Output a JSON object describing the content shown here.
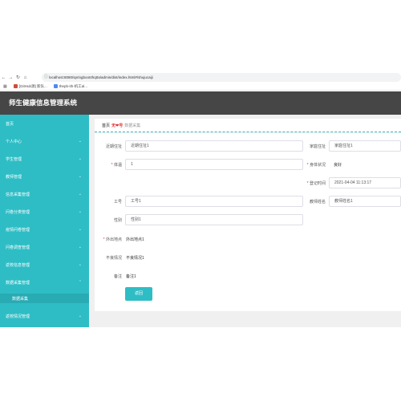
{
  "browser": {
    "url": "localhost:8080/springboot4hq0a/admin/dist/index.html#/shujucaiji",
    "bookmarks": [
      {
        "label": "[GitHub源] 新队...",
        "color": "#d4493a"
      },
      {
        "label": "thepb-ith-机工al...",
        "color": "#4a8af4"
      }
    ]
  },
  "app": {
    "title": "师生健康信息管理系统"
  },
  "sidebar": {
    "items": [
      {
        "label": "首页"
      },
      {
        "label": "个人中心"
      },
      {
        "label": "学生管理"
      },
      {
        "label": "教师管理"
      },
      {
        "label": "信息采集管理"
      },
      {
        "label": "问卷分类管理"
      },
      {
        "label": "疫情问卷管理"
      },
      {
        "label": "问卷调查管理"
      },
      {
        "label": "返校信息管理"
      },
      {
        "label": "数据采集管理"
      },
      {
        "label": "数据采集"
      },
      {
        "label": "返校情况管理"
      }
    ]
  },
  "breadcrumb": {
    "home": "首页",
    "separator": "无❤号",
    "current": "数据采集"
  },
  "form": {
    "recent_address_label": "近期住址",
    "recent_address_value": "近期住址1",
    "home_address_label": "家庭住址",
    "home_address_value": "家庭住址1",
    "temperature_label": "体温",
    "temperature_value": "1",
    "body_status_label": "身体状况",
    "body_status_value": "良好",
    "register_time_label": "登记时间",
    "register_time_value": "2021-04-04 11:13:17",
    "staff_id_label": "工号",
    "staff_id_value": "工号1",
    "teacher_name_label": "教师姓名",
    "teacher_name_value": "教师姓名1",
    "gender_label": "性别",
    "gender_value": "性别1",
    "outing_label": "外出地点",
    "outing_value": "外出地点1",
    "symptoms_label": "不良情况",
    "symptoms_value": "不良情况1",
    "remarks_label": "备注",
    "remarks_value": "备注1",
    "back_button": "返回"
  }
}
